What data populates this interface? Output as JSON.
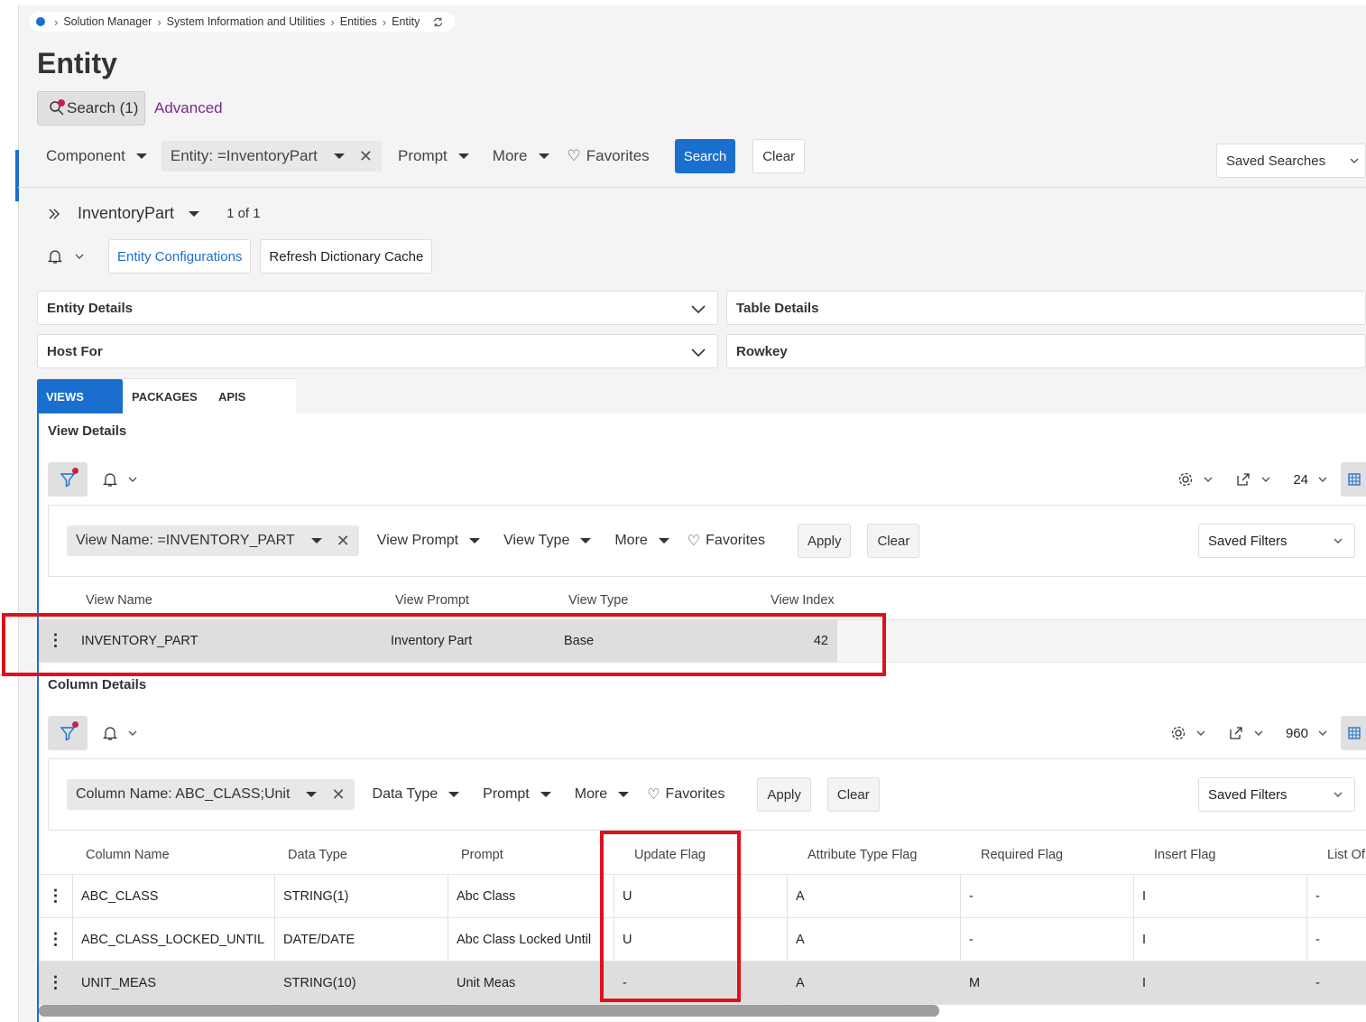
{
  "breadcrumb": [
    "Solution Manager",
    "System Information and Utilities",
    "Entities",
    "Entity"
  ],
  "page_title": "Entity",
  "search_tab": "Search (1)",
  "advanced_tab": "Advanced",
  "filters": {
    "component": "Component",
    "entity_chip": "Entity: =InventoryPart",
    "prompt": "Prompt",
    "more": "More",
    "favorites": "Favorites",
    "search_btn": "Search",
    "clear_btn": "Clear",
    "saved_searches": "Saved Searches"
  },
  "record": {
    "name": "InventoryPart",
    "count": "1 of 1"
  },
  "actions": {
    "entity_configurations": "Entity Configurations",
    "refresh_cache": "Refresh Dictionary Cache"
  },
  "groups": {
    "entity_details": "Entity Details",
    "table_details": "Table Details",
    "host_for": "Host For",
    "rowkey": "Rowkey"
  },
  "tabs": [
    "VIEWS",
    "PACKAGES",
    "APIS"
  ],
  "view_details": {
    "title": "View Details",
    "page_size": "24",
    "filter_chip": "View Name: =INVENTORY_PART",
    "view_prompt": "View Prompt",
    "view_type": "View Type",
    "more": "More",
    "favorites": "Favorites",
    "apply": "Apply",
    "clear": "Clear",
    "saved_filters": "Saved Filters",
    "columns": [
      "View Name",
      "View Prompt",
      "View Type",
      "View Index"
    ],
    "rows": [
      [
        "INVENTORY_PART",
        "Inventory Part",
        "Base",
        "42"
      ]
    ]
  },
  "column_details": {
    "title": "Column Details",
    "page_size": "960",
    "filter_chip": "Column Name: ABC_CLASS;Unit",
    "data_type": "Data Type",
    "prompt": "Prompt",
    "more": "More",
    "favorites": "Favorites",
    "apply": "Apply",
    "clear": "Clear",
    "saved_filters": "Saved Filters",
    "columns": [
      "Column Name",
      "Data Type",
      "Prompt",
      "Update Flag",
      "Attribute Type Flag",
      "Required Flag",
      "Insert Flag",
      "List Of V"
    ],
    "rows": [
      [
        "ABC_CLASS",
        "STRING(1)",
        "Abc Class",
        "U",
        "A",
        "-",
        "I",
        "-"
      ],
      [
        "ABC_CLASS_LOCKED_UNTIL",
        "DATE/DATE",
        "Abc Class Locked Until",
        "U",
        "A",
        "-",
        "I",
        "-"
      ],
      [
        "UNIT_MEAS",
        "STRING(10)",
        "Unit Meas",
        "-",
        "A",
        "M",
        "I",
        "-"
      ]
    ]
  },
  "colors": {
    "accent": "#1a6fce",
    "highlight": "#e0101b",
    "badge": "#c4224a",
    "advanced": "#7b2c8a"
  }
}
